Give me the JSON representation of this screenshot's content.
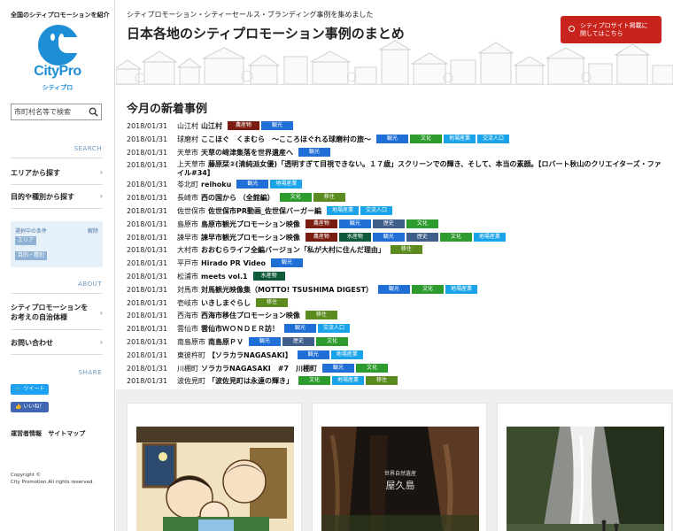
{
  "sidebar": {
    "tagline": "全国のシティプロモーションを紹介",
    "logo_text": "CityPro",
    "logo_sub": "シティプロ",
    "search_placeholder": "市町村名等で検索",
    "search_label": "SEARCH",
    "nav_area": "エリアから探す",
    "nav_purpose": "目的や種別から探す",
    "conditions_title": "選択中の条件",
    "conditions_clear": "解除",
    "conditions_tags": [
      "エリア",
      "目的・種別"
    ],
    "about_label": "ABOUT",
    "about_link": "シティプロモーションをお考えの自治体様",
    "contact_link": "お問い合わせ",
    "share_label": "SHARE",
    "tweet_label": "ツイート",
    "like_label": "いいね！",
    "footer_operator": "運営者情報",
    "footer_sitemap": "サイトマップ",
    "copyright_1": "Copyright ©",
    "copyright_2": "City Promotion.All rights reserved."
  },
  "header": {
    "tagline": "シティプロモーション・シティーセールス・ブランディング事例を集めました",
    "title": "日本各地のシティプロモーション事例のまとめ",
    "cta_line1": "シティプロサイト掲載に",
    "cta_line2": "関してはこちら"
  },
  "news": {
    "heading": "今月の新着事例",
    "rows": [
      {
        "date": "2018/01/31",
        "city": "山江村",
        "title": "山江村",
        "tags": [
          {
            "label": "農産物",
            "color": "#7a1c10"
          },
          {
            "label": "観光",
            "color": "#1f6fd6"
          }
        ]
      },
      {
        "date": "2018/01/31",
        "city": "球磨村",
        "title": "ここほぐ　くまむら　～こころほぐれる球磨村の旅～",
        "tags": [
          {
            "label": "観光",
            "color": "#1f6fd6"
          },
          {
            "label": "文化",
            "color": "#2e9b2e"
          },
          {
            "label": "地場産業",
            "color": "#1aa3e8"
          },
          {
            "label": "交流人口",
            "color": "#1aa3e8"
          }
        ]
      },
      {
        "date": "2018/01/31",
        "city": "天草市",
        "title": "天草の﨑津集落を世界遺産へ",
        "tags": [
          {
            "label": "観光",
            "color": "#1f6fd6"
          }
        ]
      },
      {
        "date": "2018/01/31",
        "city": "上天草市",
        "title": "藤原栞②(清純派女優)「透明すぎて目視できない。１７歳」スクリーンでの輝き、そして、本当の素顔。【ロバート秋山のクリエイターズ・ファイル#34】",
        "tags": []
      },
      {
        "date": "2018/01/31",
        "city": "苓北町",
        "title": "reihoku",
        "tags": [
          {
            "label": "観光",
            "color": "#1f6fd6"
          },
          {
            "label": "地場産業",
            "color": "#1aa3e8"
          }
        ]
      },
      {
        "date": "2018/01/31",
        "city": "長崎市",
        "title": "西の国から （全館編）",
        "tags": [
          {
            "label": "文化",
            "color": "#2e9b2e"
          },
          {
            "label": "移住",
            "color": "#5b8a1e"
          }
        ]
      },
      {
        "date": "2018/01/31",
        "city": "佐世保市",
        "title": "佐世保市PR動画_佐世保バーガー編",
        "tags": [
          {
            "label": "地場産業",
            "color": "#1aa3e8"
          },
          {
            "label": "交流人口",
            "color": "#1aa3e8"
          }
        ]
      },
      {
        "date": "2018/01/31",
        "city": "島原市",
        "title": "島原市観光プロモーション映像",
        "tags": [
          {
            "label": "農産物",
            "color": "#7a1c10"
          },
          {
            "label": "観光",
            "color": "#1f6fd6"
          },
          {
            "label": "歴史",
            "color": "#3f5f8a"
          },
          {
            "label": "文化",
            "color": "#2e9b2e"
          }
        ]
      },
      {
        "date": "2018/01/31",
        "city": "諫早市",
        "title": "諫早市観光プロモーション映像",
        "tags": [
          {
            "label": "農産物",
            "color": "#7a1c10"
          },
          {
            "label": "水産物",
            "color": "#0f5a3a"
          },
          {
            "label": "観光",
            "color": "#1f6fd6"
          },
          {
            "label": "歴史",
            "color": "#3f5f8a"
          },
          {
            "label": "文化",
            "color": "#2e9b2e"
          },
          {
            "label": "地場産業",
            "color": "#1aa3e8"
          }
        ]
      },
      {
        "date": "2018/01/31",
        "city": "大村市",
        "title": "おおむらライフ全編バージョン「私が大村に住んだ理由」",
        "tags": [
          {
            "label": "移住",
            "color": "#5b8a1e"
          }
        ]
      },
      {
        "date": "2018/01/31",
        "city": "平戸市",
        "title": "Hirado PR Video",
        "tags": [
          {
            "label": "観光",
            "color": "#1f6fd6"
          }
        ]
      },
      {
        "date": "2018/01/31",
        "city": "松浦市",
        "title": "meets vol.1",
        "tags": [
          {
            "label": "水産物",
            "color": "#0f5a3a"
          }
        ]
      },
      {
        "date": "2018/01/31",
        "city": "対馬市",
        "title": "対馬観光映像集（MOTTO! TSUSHIMA DIGEST）",
        "tags": [
          {
            "label": "観光",
            "color": "#1f6fd6"
          },
          {
            "label": "文化",
            "color": "#2e9b2e"
          },
          {
            "label": "地場産業",
            "color": "#1aa3e8"
          }
        ]
      },
      {
        "date": "2018/01/31",
        "city": "壱岐市",
        "title": "いきしまぐらし",
        "tags": [
          {
            "label": "移住",
            "color": "#5b8a1e"
          }
        ]
      },
      {
        "date": "2018/01/31",
        "city": "西海市",
        "title": "西海市移住プロモーション映像",
        "tags": [
          {
            "label": "移住",
            "color": "#5b8a1e"
          }
        ]
      },
      {
        "date": "2018/01/31",
        "city": "雲仙市",
        "title": "雲仙市ＷＯＮＤＥＲ訪！",
        "tags": [
          {
            "label": "観光",
            "color": "#1f6fd6"
          },
          {
            "label": "交流人口",
            "color": "#1aa3e8"
          }
        ]
      },
      {
        "date": "2018/01/31",
        "city": "南島原市",
        "title": "南島原ＰＶ",
        "tags": [
          {
            "label": "観光",
            "color": "#1f6fd6"
          },
          {
            "label": "歴史",
            "color": "#3f5f8a"
          },
          {
            "label": "文化",
            "color": "#2e9b2e"
          }
        ]
      },
      {
        "date": "2018/01/31",
        "city": "東彼杵町",
        "title": "【ソラカラNAGASAKI】",
        "tags": [
          {
            "label": "観光",
            "color": "#1f6fd6"
          },
          {
            "label": "地場産業",
            "color": "#1aa3e8"
          }
        ]
      },
      {
        "date": "2018/01/31",
        "city": "川棚町",
        "title": "ソラカラNAGASAKI　#7　川棚町",
        "tags": [
          {
            "label": "観光",
            "color": "#1f6fd6"
          },
          {
            "label": "文化",
            "color": "#2e9b2e"
          }
        ]
      },
      {
        "date": "2018/01/31",
        "city": "波佐見町",
        "title": "「波佐見町は永遠の輝き」",
        "tags": [
          {
            "label": "文化",
            "color": "#2e9b2e"
          },
          {
            "label": "地場産業",
            "color": "#1aa3e8"
          },
          {
            "label": "移住",
            "color": "#5b8a1e"
          }
        ]
      }
    ]
  },
  "gallery": {
    "card2_caption_1": "世界自然遺産",
    "card2_caption_2": "屋久島"
  }
}
